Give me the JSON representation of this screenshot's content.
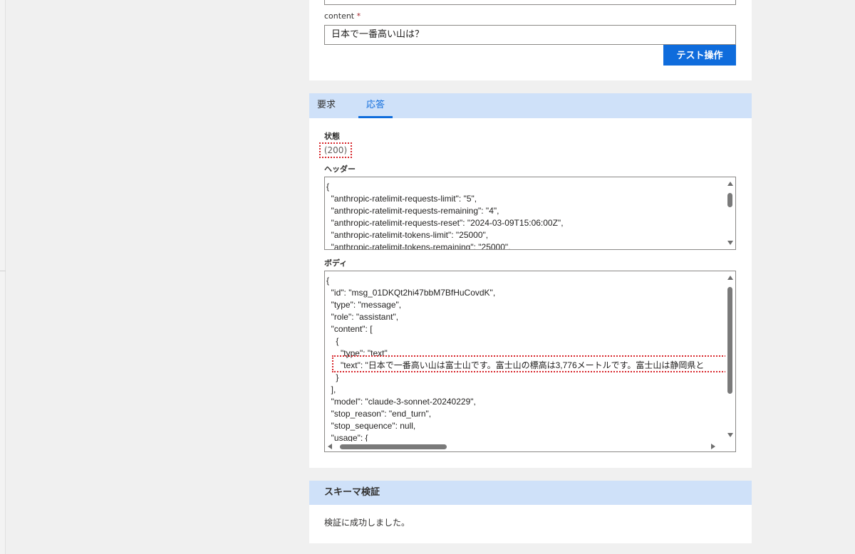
{
  "test_section": {
    "content_label": "content",
    "required_mark": "*",
    "content_value": "日本で一番高い山は？",
    "test_button": "テスト操作"
  },
  "response_section": {
    "tabs": [
      "要求",
      "応答"
    ],
    "active_tab": "応答",
    "status_label": "状態",
    "status_value": "(200)",
    "headers_label": "ヘッダー",
    "headers_text": "{\n  \"anthropic-ratelimit-requests-limit\": \"5\",\n  \"anthropic-ratelimit-requests-remaining\": \"4\",\n  \"anthropic-ratelimit-requests-reset\": \"2024-03-09T15:06:00Z\",\n  \"anthropic-ratelimit-tokens-limit\": \"25000\",\n  \"anthropic-ratelimit-tokens-remaining\": \"25000\",",
    "body_label": "ボディ",
    "body_text": "{\n  \"id\": \"msg_01DKQt2hi47bbM7BfHuCovdK\",\n  \"type\": \"message\",\n  \"role\": \"assistant\",\n  \"content\": [\n    {\n      \"type\": \"text\",\n      \"text\": \"日本で一番高い山は富士山です。富士山の標高は3,776メートルです。富士山は静岡県と\n    }\n  ],\n  \"model\": \"claude-3-sonnet-20240229\",\n  \"stop_reason\": \"end_turn\",\n  \"stop_sequence\": null,\n  \"usage\": {"
  },
  "schema_section": {
    "title": "スキーマ検証",
    "message": "検証に成功しました。"
  },
  "colors": {
    "accent": "#0f6cdc",
    "header_band": "#cfe1f9",
    "highlight_border": "#d7262b"
  }
}
